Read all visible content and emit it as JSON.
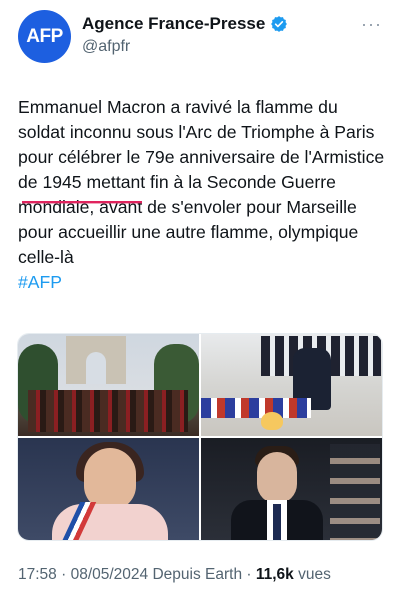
{
  "account": {
    "avatar_text": "AFP",
    "display_name": "Agence France-Presse",
    "handle": "@afpfr",
    "more_label": "···",
    "avatar_color": "#1d5fe0",
    "verified_color": "#1d9bf0"
  },
  "tweet": {
    "text": "Emmanuel Macron a ravivé la flamme du soldat inconnu sous l'Arc de Triomphe à Paris pour célébrer le 79e anniversaire de l'Armistice de 1945 mettant fin à la Seconde Guerre mondiale, avant de s'envoler pour Marseille pour accueillir une autre flamme, olympique celle-là",
    "hashtag": "#AFP"
  },
  "media": {
    "photos": [
      {
        "name": "arc-de-triomphe-cavalry-photo"
      },
      {
        "name": "macron-flame-photo"
      },
      {
        "name": "anne-hidalgo-photo"
      },
      {
        "name": "gabriel-attal-photo"
      }
    ]
  },
  "meta": {
    "time": "17:58",
    "separator": " · ",
    "date": "08/05/2024",
    "source": "Depuis Earth",
    "views_count": "11,6k",
    "views_label": "vues"
  }
}
